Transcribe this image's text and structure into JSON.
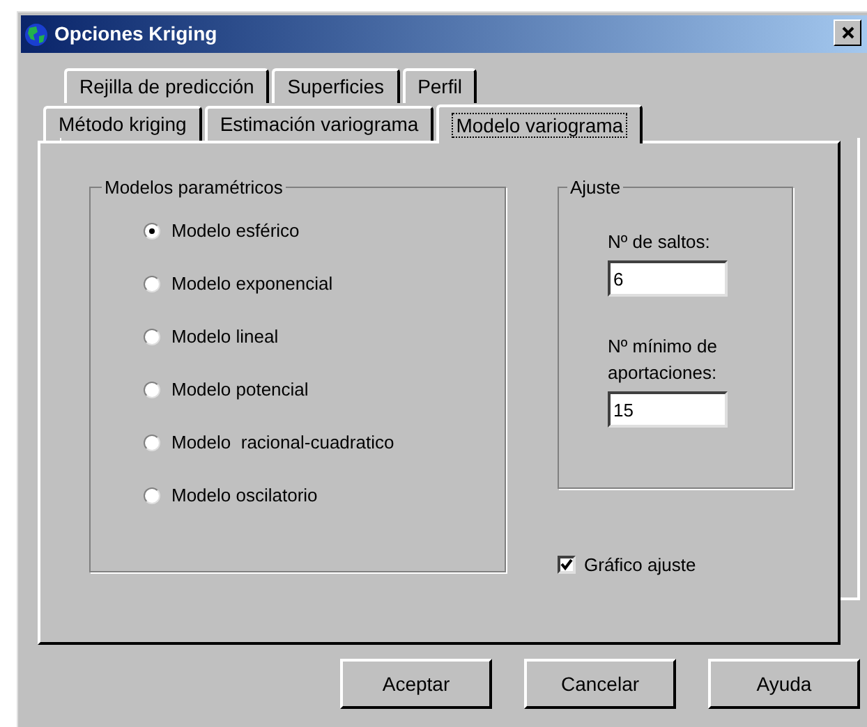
{
  "window": {
    "title": "Opciones Kriging"
  },
  "tab_rows": [
    [
      {
        "label": "Rejilla de predicción",
        "selected": false
      },
      {
        "label": "Superficies",
        "selected": false
      },
      {
        "label": "Perfil",
        "selected": false
      }
    ],
    [
      {
        "label": "Método kriging",
        "selected": false
      },
      {
        "label": "Estimación variograma",
        "selected": false
      },
      {
        "label": "Modelo variograma",
        "selected": true
      }
    ]
  ],
  "models": {
    "title": "Modelos paramétricos",
    "options": [
      {
        "label": "Modelo esférico",
        "selected": true
      },
      {
        "label": "Modelo exponencial",
        "selected": false
      },
      {
        "label": "Modelo lineal",
        "selected": false
      },
      {
        "label": "Modelo potencial",
        "selected": false
      },
      {
        "label": "Modelo  racional-cuadratico",
        "selected": false
      },
      {
        "label": "Modelo oscilatorio",
        "selected": false
      }
    ]
  },
  "fit": {
    "title": "Ajuste",
    "fields": [
      {
        "label": "Nº de saltos:",
        "value": "6"
      },
      {
        "label": "Nº mínimo de aportaciones:",
        "value": "15"
      }
    ]
  },
  "fit_chart": {
    "label": "Gráfico ajuste",
    "checked": true
  },
  "buttons": [
    "Aceptar",
    "Cancelar",
    "Ayuda"
  ]
}
